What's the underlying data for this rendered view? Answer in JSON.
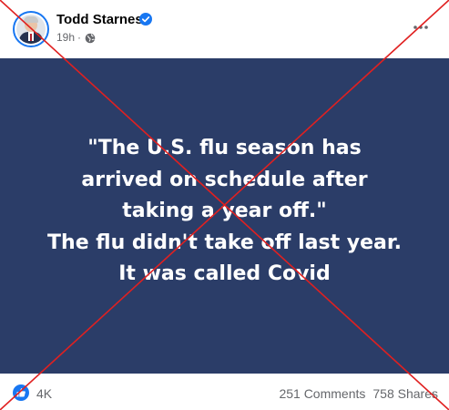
{
  "post": {
    "author": "Todd Starnes",
    "timestamp": "19h",
    "separator": "·",
    "image_text": "\"The U.S. flu season has\narrived on schedule after\ntaking a year off.\"\nThe flu didn't take off last year.\nIt was called Covid",
    "image_background": "#2b3d68",
    "reactions": "4K",
    "comments": "251 Comments",
    "shares": "758 Shares"
  },
  "icons": {
    "avatar": "profile-photo",
    "verified": "verified-badge-icon",
    "privacy": "globe-icon",
    "menu": "more-options-icon",
    "reaction": "like-icon"
  },
  "colors": {
    "accent": "#1877f2",
    "muted_text": "#65676b",
    "overlay_cross": "#e02020"
  }
}
